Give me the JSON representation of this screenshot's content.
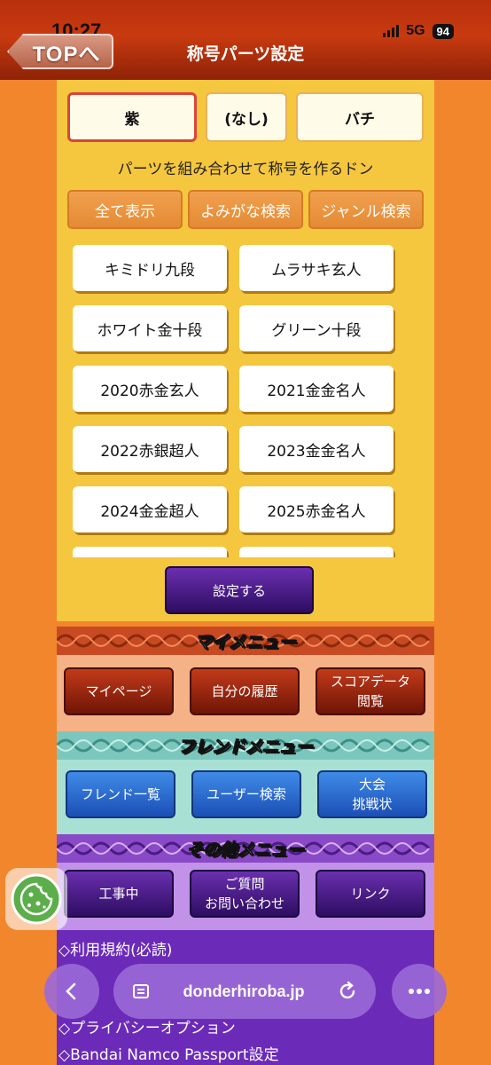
{
  "status_bar": {
    "time": "10:27",
    "network": "5G",
    "battery": "94"
  },
  "header": {
    "back_label": "TOPへ",
    "title": "称号パーツ設定"
  },
  "parts": [
    "紫",
    "(なし)",
    "バチ"
  ],
  "hint": "パーツを組み合わせて称号を作るドン",
  "filters": [
    "全て表示",
    "よみがな検索",
    "ジャンル検索"
  ],
  "titles": [
    "キミドリ九段",
    "ムラサキ玄人",
    "ホワイト金十段",
    "グリーン十段",
    "2020赤金玄人",
    "2021金金名人",
    "2022赤銀超人",
    "2023金金名人",
    "2024金金超人",
    "2025赤金名人"
  ],
  "set_button": "設定する",
  "my_menu": {
    "title": "マイメニュー",
    "items": [
      {
        "l1": "マイページ",
        "l2": ""
      },
      {
        "l1": "自分の履歴",
        "l2": ""
      },
      {
        "l1": "スコアデータ",
        "l2": "閲覧"
      }
    ]
  },
  "friend_menu": {
    "title": "フレンドメニュー",
    "items": [
      {
        "l1": "フレンド一覧",
        "l2": ""
      },
      {
        "l1": "ユーザー検索",
        "l2": ""
      },
      {
        "l1": "大会",
        "l2": "挑戦状"
      }
    ]
  },
  "other_menu": {
    "title": "その他メニュー",
    "items": [
      {
        "l1": "工事中",
        "l2": ""
      },
      {
        "l1": "ご質問",
        "l2": "お問い合わせ"
      },
      {
        "l1": "リンク",
        "l2": ""
      }
    ]
  },
  "footer_links": [
    "◇利用規約(必読)",
    "◇プライバシーオプション",
    "◇Bandai Namco Passport設定"
  ],
  "browser": {
    "url": "donderhiroba.jp"
  },
  "colors": {
    "header_red": "#c83a10",
    "panel_yellow": "#f5c73f",
    "orange_bg": "#f2862c",
    "my_menu_bg": "#f6b287",
    "friend_menu_bg": "#a8e0d4",
    "other_menu_bg": "#c292e8"
  }
}
